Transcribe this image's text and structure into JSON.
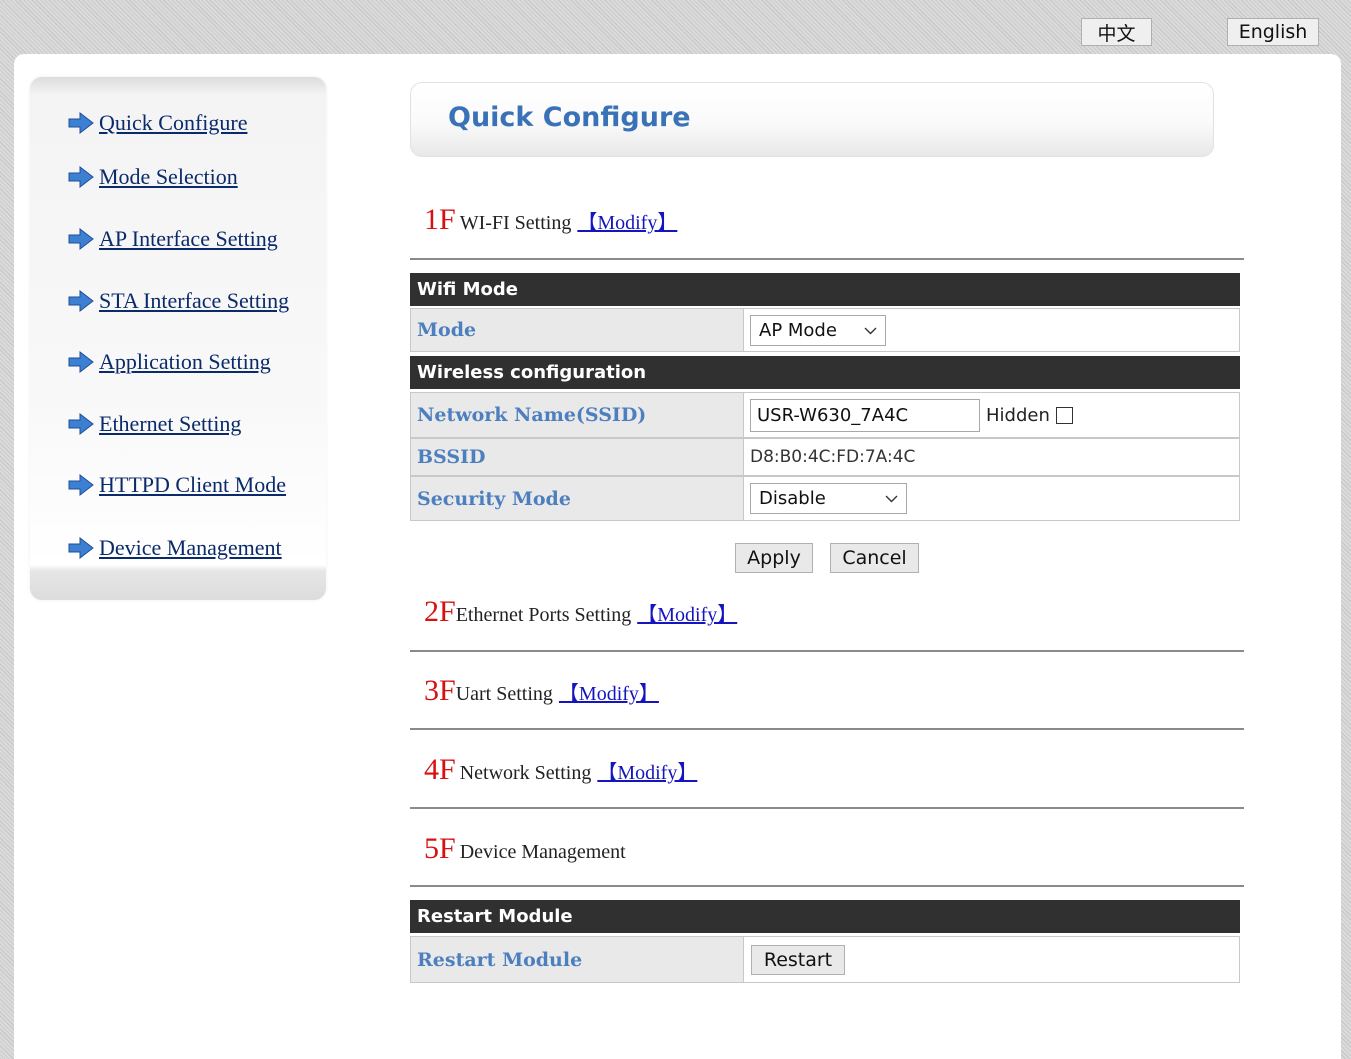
{
  "top_bar": {
    "lang_chinese": "中文",
    "lang_english": "English"
  },
  "sidebar": {
    "items": [
      {
        "label": "Quick Configure"
      },
      {
        "label": "Mode Selection"
      },
      {
        "label": "AP Interface Setting"
      },
      {
        "label": "STA Interface Setting"
      },
      {
        "label": "Application Setting"
      },
      {
        "label": "Ethernet Setting"
      },
      {
        "label": "HTTPD Client Mode"
      },
      {
        "label": "Device Management"
      }
    ],
    "icon": "arrow-right-icon",
    "link_color": "#0a2a6a"
  },
  "header": {
    "title": "Quick Configure"
  },
  "sections": [
    {
      "num": "1F",
      "name": "WI-FI Setting",
      "modify": "【Modify】"
    },
    {
      "num": "2F",
      "name": "Ethernet Ports Setting",
      "modify": "【Modify】"
    },
    {
      "num": "3F",
      "name": "Uart Setting",
      "modify": "【Modify】"
    },
    {
      "num": "4F",
      "name": "Network Setting",
      "modify": "【Modify】"
    },
    {
      "num": "5F",
      "name": "Device Management"
    }
  ],
  "wifi": {
    "wifi_mode_header": "Wifi Mode",
    "mode_label": "Mode",
    "mode_value": "AP Mode",
    "wireless_header": "Wireless configuration",
    "ssid_label": "Network Name(SSID)",
    "ssid_value": "USR-W630_7A4C",
    "hidden_label": "Hidden",
    "hidden_checked": false,
    "bssid_label": "BSSID",
    "bssid_value": "D8:B0:4C:FD:7A:4C",
    "security_label": "Security Mode",
    "security_value": "Disable",
    "apply_button": "Apply",
    "cancel_button": "Cancel"
  },
  "device_management": {
    "restart_header": "Restart Module",
    "restart_label": "Restart Module",
    "restart_button": "Restart"
  },
  "colors": {
    "section_number": "#d81010",
    "modify_link": "#1515c0",
    "row_label": "#4d7fbf",
    "band": "#303030",
    "title": "#3a72b8"
  }
}
